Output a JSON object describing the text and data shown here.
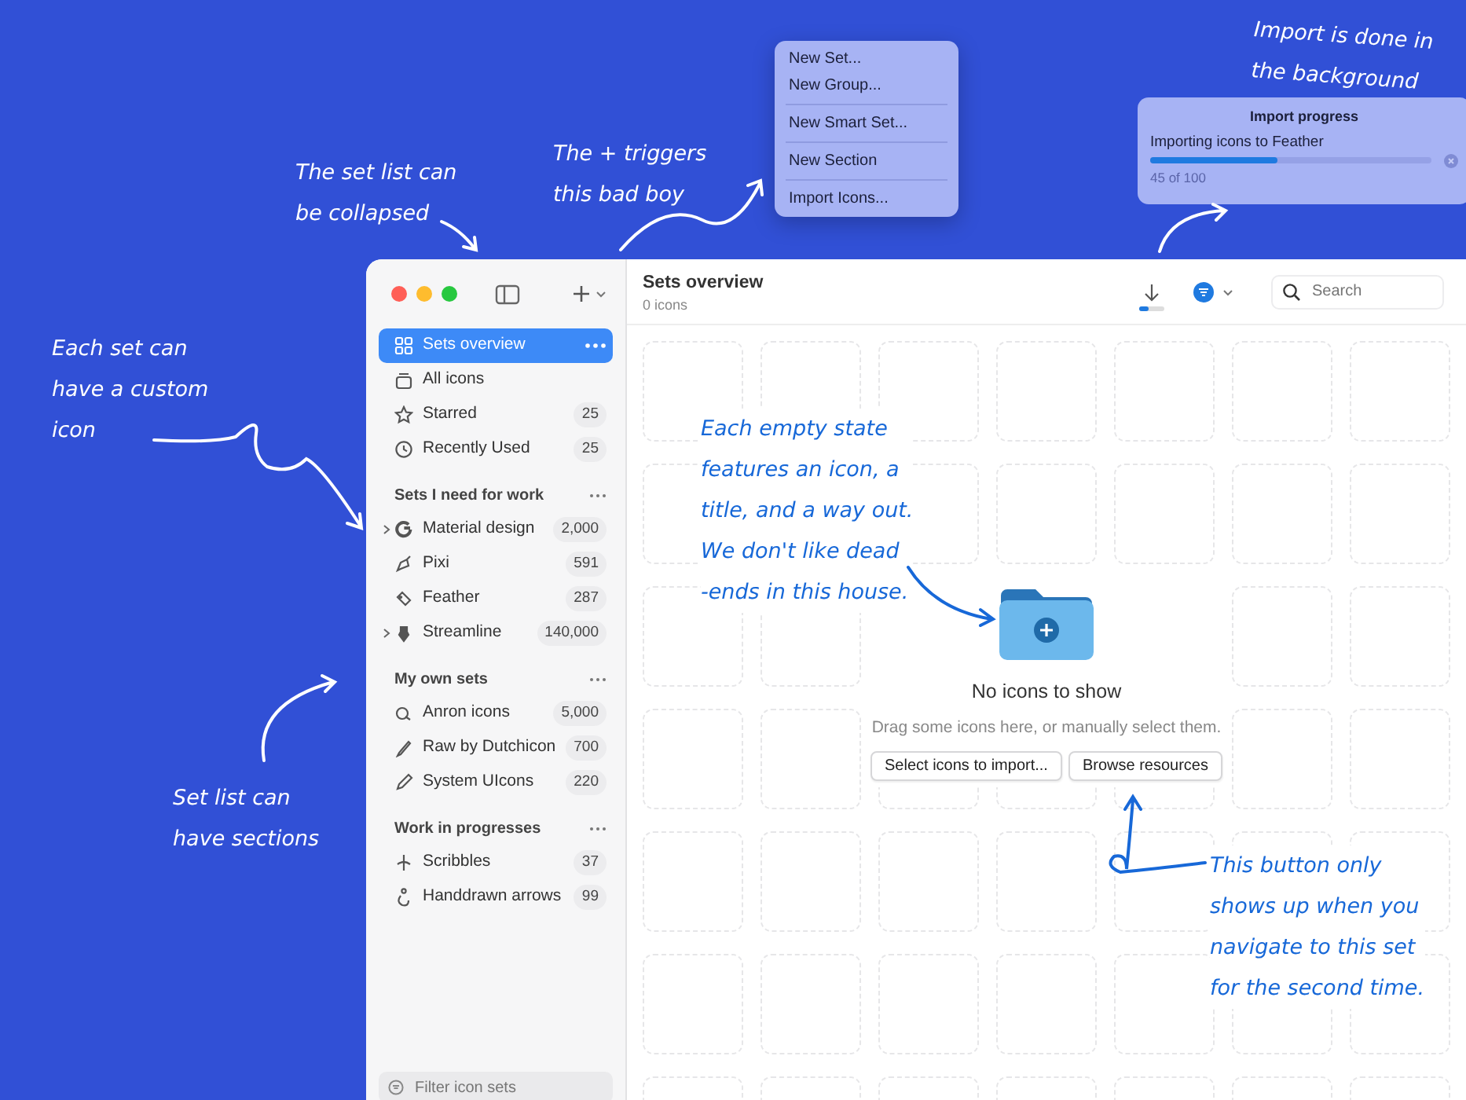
{
  "annotations": [
    {
      "lines": [
        "The set list can",
        "be collapsed"
      ],
      "color": "#ffffff"
    },
    {
      "lines": [
        "The + triggers",
        "this bad boy"
      ],
      "color": "#ffffff"
    },
    {
      "lines": [
        "Import is done in",
        "the background"
      ],
      "color": "#ffffff"
    },
    {
      "lines": [
        "Each set can",
        "have a custom",
        "icon"
      ],
      "color": "#ffffff"
    },
    {
      "lines": [
        "Set list can",
        "have sections"
      ],
      "color": "#ffffff"
    },
    {
      "lines": [
        "Each empty state",
        "features an icon, a",
        "title, and a way out.",
        "We don't like dead",
        "-ends in this house."
      ],
      "color": "#1768d8"
    },
    {
      "lines": [
        "This button only",
        "shows up when you",
        "navigate to this set",
        "for the second time."
      ],
      "color": "#1768d8"
    }
  ],
  "add_menu": {
    "groups": [
      [
        "New Set...",
        "New Group..."
      ],
      [
        "New Smart Set..."
      ],
      [
        "New Section"
      ],
      [
        "Import Icons..."
      ]
    ]
  },
  "import_popover": {
    "title": "Import progress",
    "task": "Importing icons to Feather",
    "level": 0.45,
    "count": "45 of 100"
  },
  "sidebar": {
    "items": [
      {
        "label": "Sets overview",
        "selected": true
      },
      {
        "label": "All icons",
        "selected": false
      },
      {
        "label": "Starred",
        "count": "25",
        "selected": false
      },
      {
        "label": "Recently Used",
        "count": "25",
        "selected": false
      }
    ],
    "sections": [
      {
        "title": "Sets I need for work",
        "items": [
          {
            "label": "Material design",
            "count": "2,000",
            "expandable": true,
            "selected": false
          },
          {
            "label": "Pixi",
            "count": "591",
            "expandable": false,
            "selected": false
          },
          {
            "label": "Feather",
            "count": "287",
            "expandable": false,
            "selected": false
          },
          {
            "label": "Streamline",
            "count": "140,000",
            "expandable": true,
            "selected": false
          }
        ]
      },
      {
        "title": "My own sets",
        "items": [
          {
            "label": "Anron icons",
            "count": "5,000",
            "expandable": false,
            "selected": false
          },
          {
            "label": "Raw by Dutchicon",
            "count": "700",
            "expandable": false,
            "selected": false
          },
          {
            "label": "System UIcons",
            "count": "220",
            "expandable": false,
            "selected": false
          }
        ]
      },
      {
        "title": "Work in progresses",
        "items": [
          {
            "label": "Scribbles",
            "count": "37",
            "expandable": false,
            "selected": false
          },
          {
            "label": "Handdrawn arrows",
            "count": "99",
            "expandable": false,
            "selected": false
          }
        ]
      }
    ],
    "filter": {
      "placeholder": "Filter icon sets"
    }
  },
  "toolbar": {
    "title": "Sets overview",
    "subtitle": "0 icons",
    "download": {
      "level": 0.4
    },
    "search": {
      "placeholder": "Search"
    }
  },
  "empty_state": {
    "title": "No icons to show",
    "message": "Drag some icons here, or manually select them.",
    "buttons": [
      "Select icons to import...",
      "Browse resources"
    ]
  }
}
